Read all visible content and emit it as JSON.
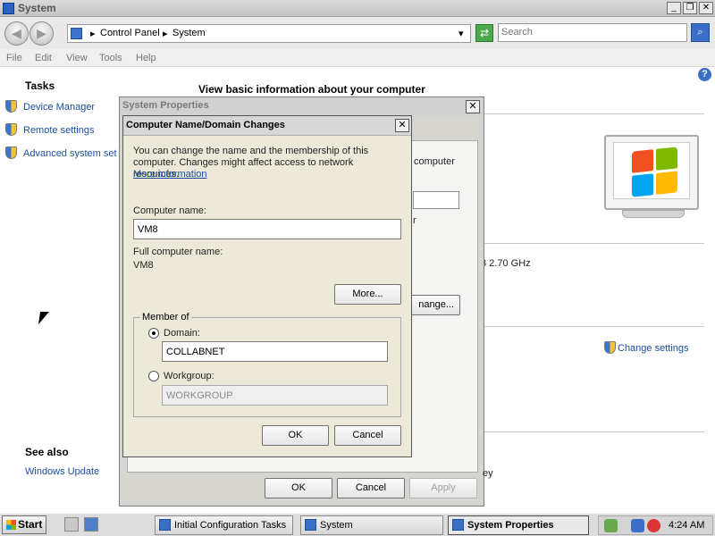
{
  "window": {
    "title": "System"
  },
  "address": {
    "segments": [
      "Control Panel",
      "System"
    ],
    "search_placeholder": "Search"
  },
  "menu": [
    "File",
    "Edit",
    "View",
    "Tools",
    "Help"
  ],
  "left_pane": {
    "tasks_title": "Tasks",
    "tasks": [
      "Device Manager",
      "Remote settings",
      "Advanced system set"
    ],
    "see_also_title": "See also",
    "see_also": [
      "Windows Update"
    ]
  },
  "main": {
    "heading": "View basic information about your computer",
    "fragments": {
      "computer": "computer",
      "r": "r",
      "cpu": "3  2.70 GHz",
      "change": "nange...",
      "ey": "ey"
    },
    "change_settings": "Change settings"
  },
  "system_properties": {
    "title": "System Properties",
    "buttons": {
      "ok": "OK",
      "cancel": "Cancel",
      "apply": "Apply"
    }
  },
  "computer_name_dialog": {
    "title": "Computer Name/Domain Changes",
    "description": "You can change the name and the membership of this computer. Changes might affect access to network resources.",
    "more_info": "More information",
    "computer_name_label": "Computer name:",
    "computer_name_value": "VM8",
    "full_name_label": "Full computer name:",
    "full_name_value": "VM8",
    "more_button": "More...",
    "member_of_label": "Member of",
    "domain_label": "Domain:",
    "domain_value": "COLLABNET",
    "domain_selected": true,
    "workgroup_label": "Workgroup:",
    "workgroup_value": "WORKGROUP",
    "ok": "OK",
    "cancel": "Cancel"
  },
  "taskbar": {
    "start": "Start",
    "items": [
      "Initial Configuration Tasks",
      "System",
      "System Properties"
    ],
    "active_item": "System Properties",
    "clock": "4:24 AM"
  }
}
